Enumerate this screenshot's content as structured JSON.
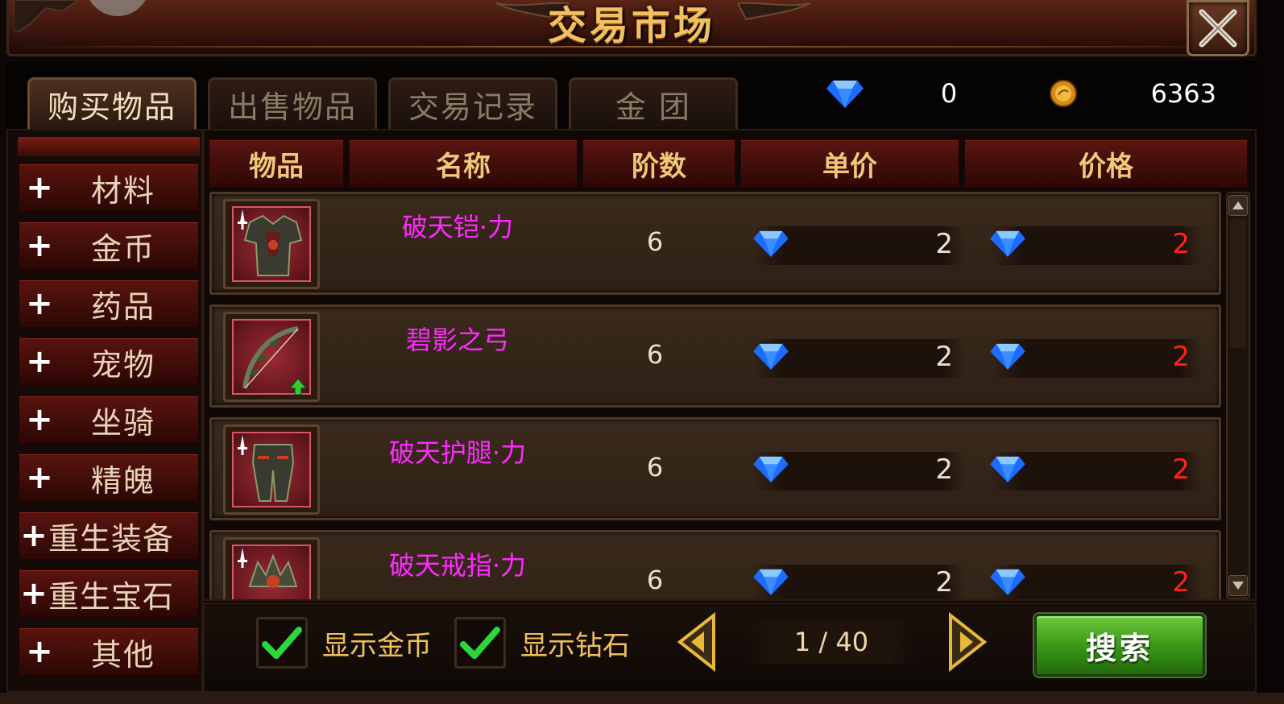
{
  "window": {
    "title": "交易市场"
  },
  "tabs": [
    {
      "label": "购买物品",
      "active": true
    },
    {
      "label": "出售物品",
      "active": false
    },
    {
      "label": "交易记录",
      "active": false
    },
    {
      "label": "金  团",
      "active": false
    }
  ],
  "currency": {
    "diamond": {
      "icon": "diamond-icon",
      "value": "0"
    },
    "gold": {
      "icon": "gold-coin-icon",
      "value": "6363"
    }
  },
  "categories": [
    {
      "label": "材料"
    },
    {
      "label": "金币"
    },
    {
      "label": "药品"
    },
    {
      "label": "宠物"
    },
    {
      "label": "坐骑"
    },
    {
      "label": "精魄"
    },
    {
      "label": "重生装备"
    },
    {
      "label": "重生宝石"
    },
    {
      "label": "其他"
    }
  ],
  "table": {
    "headers": {
      "item": "物品",
      "name": "名称",
      "tier": "阶数",
      "unit_price": "单价",
      "price": "价格"
    },
    "rows": [
      {
        "icon": "armor-icon",
        "name": "破天铠·力",
        "tier": "6",
        "unit_price": "2",
        "price": "2",
        "badge": "sword-badge-icon"
      },
      {
        "icon": "bow-icon",
        "name": "碧影之弓",
        "tier": "6",
        "unit_price": "2",
        "price": "2",
        "badge": "upgrade-arrow-icon"
      },
      {
        "icon": "leggings-icon",
        "name": "破天护腿·力",
        "tier": "6",
        "unit_price": "2",
        "price": "2",
        "badge": "sword-badge-icon"
      },
      {
        "icon": "ring-icon",
        "name": "破天戒指·力",
        "tier": "6",
        "unit_price": "2",
        "price": "2",
        "badge": "sword-badge-icon"
      }
    ]
  },
  "filters": {
    "show_gold": {
      "label": "显示金币",
      "checked": true
    },
    "show_diamond": {
      "label": "显示钻石",
      "checked": true
    }
  },
  "pager": {
    "text": "1 / 40"
  },
  "search_button": {
    "label": "搜索"
  },
  "colors": {
    "item_name": "#ff2aff",
    "price": "#ff2020",
    "title": "#f2c060",
    "search_green": "#3a9a18"
  }
}
